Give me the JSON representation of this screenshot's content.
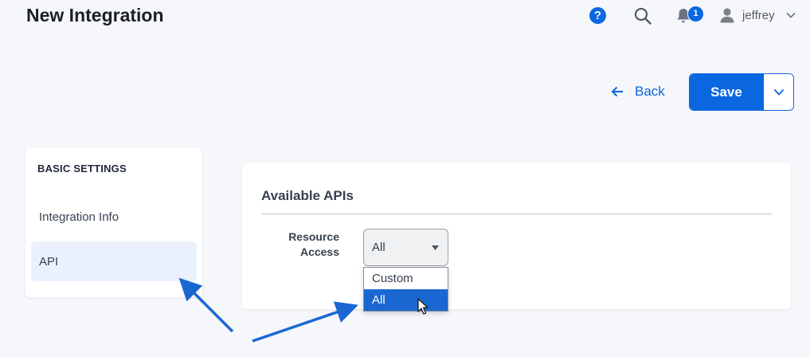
{
  "header": {
    "title": "New Integration",
    "notifications_count": "1",
    "username": "jeffrey",
    "help_glyph": "?",
    "icons": [
      "help-icon",
      "search-icon",
      "bell-icon",
      "user-icon",
      "chevron-down-icon"
    ]
  },
  "actions": {
    "back_label": "Back",
    "save_label": "Save"
  },
  "sidebar": {
    "heading": "BASIC SETTINGS",
    "items": [
      {
        "label": "Integration Info",
        "active": false
      },
      {
        "label": "API",
        "active": true
      }
    ]
  },
  "main": {
    "section_title": "Available APIs",
    "resource_access": {
      "label_line1": "Resource",
      "label_line2": "Access",
      "selected": "All",
      "options": [
        "Custom",
        "All"
      ],
      "highlighted_option": "All"
    }
  },
  "colors": {
    "accent": "#0b67e0",
    "annotation_arrow": "#1a67d2",
    "selected_option": "#1a67d2"
  }
}
